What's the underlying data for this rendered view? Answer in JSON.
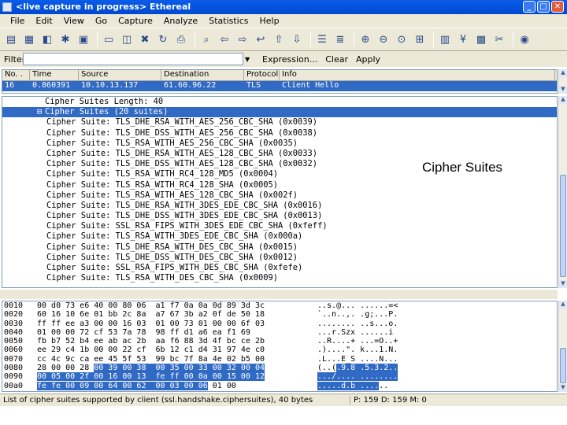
{
  "window": {
    "title": "<live capture in progress> Ethereal"
  },
  "menu": [
    "File",
    "Edit",
    "View",
    "Go",
    "Capture",
    "Analyze",
    "Statistics",
    "Help"
  ],
  "filter": {
    "label": "Filter:",
    "value": "",
    "expression": "Expression...",
    "clear": "Clear",
    "apply": "Apply"
  },
  "packet_list": {
    "columns": [
      "No. .",
      "Time",
      "Source",
      "Destination",
      "Protocol",
      "Info"
    ],
    "row": {
      "no": "16",
      "time": "0.860391",
      "source": "10.10.13.137",
      "destination": "61.60.96.22",
      "protocol": "TLS",
      "info": "Client Hello"
    }
  },
  "detail": {
    "lines": [
      {
        "text": "Cipher Suites Length: 40",
        "level": 0,
        "expander": "",
        "selected": false
      },
      {
        "text": "Cipher Suites (20 suites)",
        "level": 0,
        "expander": "⊟",
        "selected": true
      },
      {
        "text": "Cipher Suite: TLS_DHE_RSA_WITH_AES_256_CBC_SHA (0x0039)",
        "level": 1,
        "selected": false
      },
      {
        "text": "Cipher Suite: TLS_DHE_DSS_WITH_AES_256_CBC_SHA (0x0038)",
        "level": 1,
        "selected": false
      },
      {
        "text": "Cipher Suite: TLS_RSA_WITH_AES_256_CBC_SHA (0x0035)",
        "level": 1,
        "selected": false
      },
      {
        "text": "Cipher Suite: TLS_DHE_RSA_WITH_AES_128_CBC_SHA (0x0033)",
        "level": 1,
        "selected": false
      },
      {
        "text": "Cipher Suite: TLS_DHE_DSS_WITH_AES_128_CBC_SHA (0x0032)",
        "level": 1,
        "selected": false
      },
      {
        "text": "Cipher Suite: TLS_RSA_WITH_RC4_128_MD5 (0x0004)",
        "level": 1,
        "selected": false
      },
      {
        "text": "Cipher Suite: TLS_RSA_WITH_RC4_128_SHA (0x0005)",
        "level": 1,
        "selected": false
      },
      {
        "text": "Cipher Suite: TLS_RSA_WITH_AES_128_CBC_SHA (0x002f)",
        "level": 1,
        "selected": false
      },
      {
        "text": "Cipher Suite: TLS_DHE_RSA_WITH_3DES_EDE_CBC_SHA (0x0016)",
        "level": 1,
        "selected": false
      },
      {
        "text": "Cipher Suite: TLS_DHE_DSS_WITH_3DES_EDE_CBC_SHA (0x0013)",
        "level": 1,
        "selected": false
      },
      {
        "text": "Cipher Suite: SSL_RSA_FIPS_WITH_3DES_EDE_CBC_SHA (0xfeff)",
        "level": 1,
        "selected": false
      },
      {
        "text": "Cipher Suite: TLS_RSA_WITH_3DES_EDE_CBC_SHA (0x000a)",
        "level": 1,
        "selected": false
      },
      {
        "text": "Cipher Suite: TLS_DHE_RSA_WITH_DES_CBC_SHA (0x0015)",
        "level": 1,
        "selected": false
      },
      {
        "text": "Cipher Suite: TLS_DHE_DSS_WITH_DES_CBC_SHA (0x0012)",
        "level": 1,
        "selected": false
      },
      {
        "text": "Cipher Suite: SSL_RSA_FIPS_WITH_DES_CBC_SHA (0xfefe)",
        "level": 1,
        "selected": false
      },
      {
        "text": "Cipher Suite: TLS_RSA_WITH_DES_CBC_SHA (0x0009)",
        "level": 1,
        "selected": false
      }
    ],
    "callout": "Cipher Suites"
  },
  "hex": [
    {
      "off": "0010",
      "pre": "00 d0 73 e6 40 00 80 06  a1 f7 0a 0a 0d 89 3d 3c",
      "hl": "",
      "post": "",
      "apre": "..s.@... ......=<",
      "ahl": "",
      "apost": ""
    },
    {
      "off": "0020",
      "pre": "60 16 10 6e 01 bb 2c 8a  a7 67 3b a2 0f de 50 18",
      "hl": "",
      "post": "",
      "apre": "`..n..,. .g;...P.",
      "ahl": "",
      "apost": ""
    },
    {
      "off": "0030",
      "pre": "ff ff ee a3 00 00 16 03  01 00 73 01 00 00 6f 03",
      "hl": "",
      "post": "",
      "apre": "........ ..s...o.",
      "ahl": "",
      "apost": ""
    },
    {
      "off": "0040",
      "pre": "01 00 00 72 cf 53 7a 78  98 ff d1 a6 ea f1 69",
      "hl": "",
      "post": "",
      "apre": "...r.Szx ......i",
      "ahl": "",
      "apost": ""
    },
    {
      "off": "0050",
      "pre": "fb b7 52 b4 ee ab ac 2b  aa f6 88 3d 4f bc ce 2b",
      "hl": "",
      "post": "",
      "apre": "..R....+ ...=O..+",
      "ahl": "",
      "apost": ""
    },
    {
      "off": "0060",
      "pre": "ee 29 c4 1b 00 00 22 cf  6b 12 c1 d4 31 97 4e c0",
      "hl": "",
      "post": "",
      "apre": ".)....\". k...1.N.",
      "ahl": "",
      "apost": ""
    },
    {
      "off": "0070",
      "pre": "cc 4c 9c ca ee 45 5f 53  99 bc 7f 8a 4e 02 b5 00",
      "hl": "",
      "post": "",
      "apre": ".L...E_S ....N...",
      "ahl": "",
      "apost": ""
    },
    {
      "off": "0080",
      "pre": "28 00 00 28 ",
      "hl": "00 39 00 38  00 35 00 33 00 32 00 04",
      "post": "",
      "apre": "(..(",
      "ahl": ".9.8 .5.3.2..",
      "apost": ""
    },
    {
      "off": "0090",
      "pre": "",
      "hl": "00 05 00 2f 00 16 00 13  fe ff 00 0a 00 15 00 12",
      "post": "",
      "apre": "",
      "ahl": ".../.... ........",
      "apost": ""
    },
    {
      "off": "00a0",
      "pre": "",
      "hl": "fe fe 00 09 00 64 00 62  00 03 00 06",
      "post": " 01 00",
      "apre": "",
      "ahl": ".....d.b ....",
      "apost": ".."
    }
  ],
  "status": {
    "left": "List of cipher suites supported by client (ssl.handshake.ciphersuites), 40 bytes",
    "right": "P: 159 D: 159 M: 0"
  }
}
